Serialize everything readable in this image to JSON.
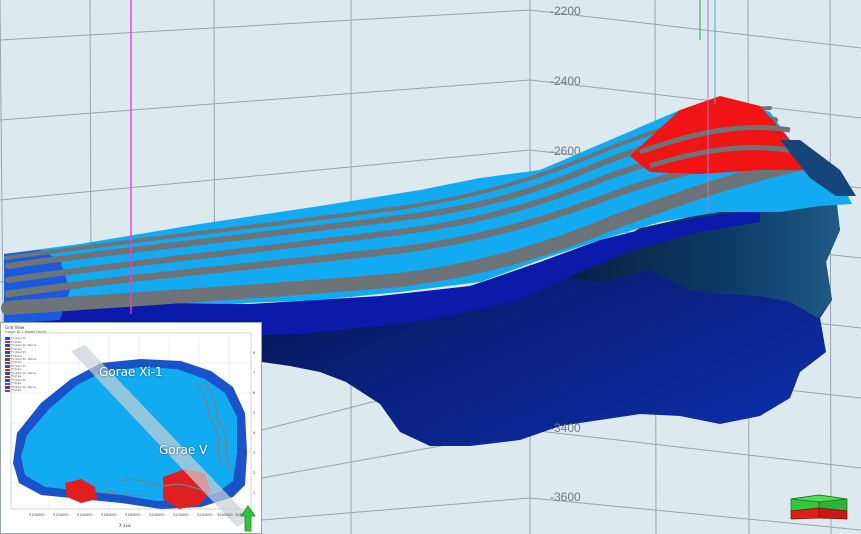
{
  "viewport": {
    "depth_labels": [
      "-2200",
      "-2400",
      "-2600",
      "-3400",
      "-3600"
    ]
  },
  "inset": {
    "title": "Grid View",
    "subtitle": "Gorae Xi-1 Model Facies",
    "wells": [
      "Gorae Xi-1",
      "Gorae V"
    ],
    "legend": [
      {
        "label": "F1 Upper SS",
        "color": "#1a52c8"
      },
      {
        "label": "F1 Shale",
        "color": "#e02020"
      },
      {
        "label": "F2 Upper SS - Marine",
        "color": "#1a52c8"
      },
      {
        "label": "F2 Shale",
        "color": "#e02020"
      },
      {
        "label": "F3 Upper SS",
        "color": "#1a52c8"
      },
      {
        "label": "F3 Shale",
        "color": "#e02020"
      },
      {
        "label": "F4 Upper SS - Marine",
        "color": "#1a52c8"
      },
      {
        "label": "F4 Shale",
        "color": "#e02020"
      },
      {
        "label": "F5 Upper SS",
        "color": "#1a52c8"
      },
      {
        "label": "F5 Shale",
        "color": "#e02020"
      },
      {
        "label": "F6 Upper SS - Marine",
        "color": "#1a52c8"
      },
      {
        "label": "F6 Shale",
        "color": "#e02020"
      },
      {
        "label": "F7 Upper SS",
        "color": "#1a52c8"
      },
      {
        "label": "F7 Shale",
        "color": "#e02020"
      },
      {
        "label": "F8 Upper SS - Marine",
        "color": "#1a52c8"
      },
      {
        "label": "F8 Shale",
        "color": "#e02020"
      }
    ],
    "x_ticks": [
      "5100000",
      "5120000",
      "5140000",
      "5160000",
      "5180000",
      "5200000",
      "5220000",
      "5240000",
      "5260000",
      "5280000"
    ],
    "x_axis_title": "X axis",
    "y_ticks": [
      "8",
      "7",
      "6",
      "5",
      "4",
      "3",
      "2",
      "1"
    ]
  },
  "colors": {
    "background": "#dce9ee",
    "grid": "#9aa5aa",
    "light_blue": "#12aaf0",
    "grey_layer": "#6e7377",
    "dark_blue": "#0b1aa8",
    "red": "#f01414",
    "well_magenta": "#e040e0",
    "well_green": "#40c060"
  }
}
